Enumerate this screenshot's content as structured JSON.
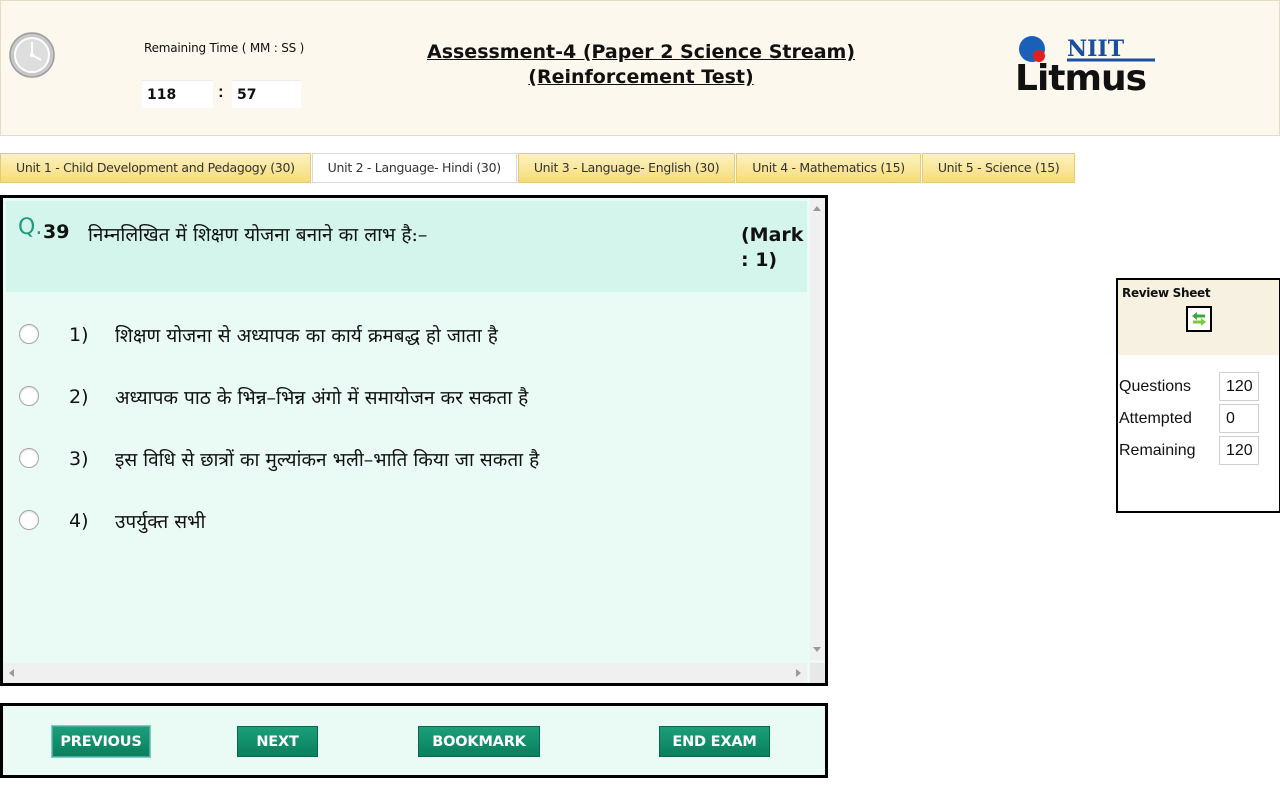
{
  "timer": {
    "label": "Remaining Time ( MM : SS )",
    "minutes": "118",
    "separator": ":",
    "seconds": "57"
  },
  "header": {
    "title_line1": "Assessment-4 (Paper 2 Science Stream)",
    "title_line2": "(Reinforcement Test)",
    "logo_top": "NIIT",
    "logo_bottom": "Litmus"
  },
  "tabs": [
    {
      "label": "Unit 1 - Child Development and Pedagogy (30)",
      "active": false
    },
    {
      "label": "Unit 2 - Language- Hindi (30)",
      "active": true
    },
    {
      "label": "Unit 3 - Language- English (30)",
      "active": false
    },
    {
      "label": "Unit 4 - Mathematics (15)",
      "active": false
    },
    {
      "label": "Unit 5 - Science (15)",
      "active": false
    }
  ],
  "question": {
    "prefix": "Q.",
    "number": "39",
    "text": "निम्नलिखित में शिक्षण योजना बनाने का लाभ है:–",
    "mark_line1": "(Mark",
    "mark_line2": ": 1)",
    "options": [
      {
        "num": "1)",
        "text": "शिक्षण योजना से अध्यापक का कार्य क्रमबद्ध हो जाता है"
      },
      {
        "num": "2)",
        "text": "अध्यापक पाठ के भिन्न–भिन्न अंगो में समायोजन कर सकता है"
      },
      {
        "num": "3)",
        "text": "इस विधि से छात्रों का मुल्यांकन भली–भाति किया जा सकता है"
      },
      {
        "num": "4)",
        "text": "उपर्युक्त सभी"
      }
    ]
  },
  "buttons": {
    "previous": "PREVIOUS",
    "next": "NEXT",
    "bookmark": "BOOKMARK",
    "end_exam": "END EXAM"
  },
  "review": {
    "title": "Review Sheet",
    "questions_label": "Questions",
    "questions_value": "120",
    "attempted_label": "Attempted",
    "attempted_value": "0",
    "remaining_label": "Remaining",
    "remaining_value": "120"
  },
  "colors": {
    "header_bg": "#fdf8ee",
    "tab_bg": "#f6dc78",
    "question_bg": "#eafaf5",
    "question_head_bg": "#d3f5eb",
    "button_green": "#0b7f5d",
    "q_prefix": "#1f9a80"
  },
  "icons": {
    "clock": "clock-icon",
    "toggle": "swap-arrows-icon"
  }
}
